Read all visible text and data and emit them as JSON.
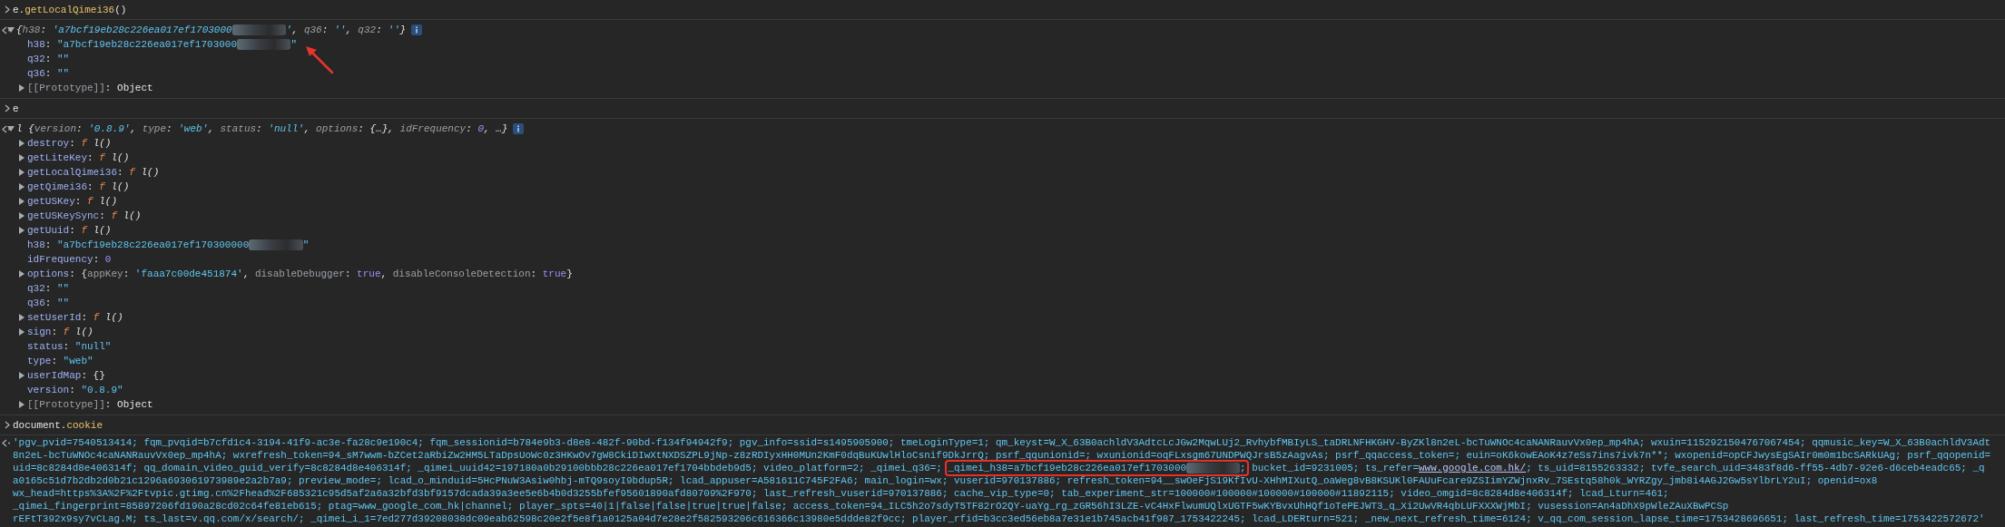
{
  "entries": [
    {
      "kind": "input",
      "tokens": [
        {
          "text": "e.",
          "kind": "punct"
        },
        {
          "text": "getLocalQimei36",
          "kind": "member"
        },
        {
          "text": "()",
          "kind": "punct"
        }
      ]
    },
    {
      "kind": "tree",
      "rows": [
        {
          "expandable": true,
          "expanded": true,
          "info": true,
          "tokens": [
            {
              "text": "{",
              "kind": "punct"
            },
            {
              "text": "h38",
              "kind": "dimkey"
            },
            {
              "text": ": ",
              "kind": "punct"
            },
            {
              "text": "'a7bcf19eb28c226ea017ef1703000",
              "kind": "string"
            },
            {
              "kind": "redacted"
            },
            {
              "text": "'",
              "kind": "string"
            },
            {
              "text": ", ",
              "kind": "punct"
            },
            {
              "text": "q36",
              "kind": "dimkey"
            },
            {
              "text": ": ",
              "kind": "punct"
            },
            {
              "text": "''",
              "kind": "string"
            },
            {
              "text": ", ",
              "kind": "punct"
            },
            {
              "text": "q32",
              "kind": "dimkey"
            },
            {
              "text": ": ",
              "kind": "punct"
            },
            {
              "text": "''",
              "kind": "string"
            },
            {
              "text": "}",
              "kind": "punct"
            }
          ],
          "children": [
            {
              "expandable": false,
              "expanded": false,
              "marked": true,
              "tokens": [
                {
                  "text": "h38",
                  "kind": "key"
                },
                {
                  "text": ": ",
                  "kind": "punct"
                },
                {
                  "text": "\"a7bcf19eb28c226ea017ef1703000",
                  "kind": "string"
                },
                {
                  "kind": "redacted"
                },
                {
                  "text": "\"",
                  "kind": "string"
                }
              ]
            },
            {
              "expandable": false,
              "expanded": false,
              "marked": false,
              "tokens": [
                {
                  "text": "q32",
                  "kind": "key"
                },
                {
                  "text": ": ",
                  "kind": "punct"
                },
                {
                  "text": "\"\"",
                  "kind": "string"
                }
              ]
            },
            {
              "expandable": false,
              "expanded": false,
              "marked": false,
              "tokens": [
                {
                  "text": "q36",
                  "kind": "key"
                },
                {
                  "text": ": ",
                  "kind": "punct"
                },
                {
                  "text": "\"\"",
                  "kind": "string"
                }
              ]
            },
            {
              "expandable": true,
              "expanded": false,
              "marked": false,
              "tokens": [
                {
                  "text": "[[Prototype]]",
                  "kind": "dimkey"
                },
                {
                  "text": ": ",
                  "kind": "punct"
                },
                {
                  "text": "Object",
                  "kind": "punct"
                }
              ]
            }
          ]
        }
      ]
    },
    {
      "kind": "input",
      "tokens": [
        {
          "text": "e",
          "kind": "punct"
        }
      ]
    },
    {
      "kind": "tree",
      "rows": [
        {
          "expandable": true,
          "expanded": true,
          "info": true,
          "tokens": [
            {
              "text": "l {",
              "kind": "punct"
            },
            {
              "text": "version",
              "kind": "dimkey"
            },
            {
              "text": ": ",
              "kind": "punct"
            },
            {
              "text": "'0.8.9'",
              "kind": "string"
            },
            {
              "text": ", ",
              "kind": "punct"
            },
            {
              "text": "type",
              "kind": "dimkey"
            },
            {
              "text": ": ",
              "kind": "punct"
            },
            {
              "text": "'web'",
              "kind": "string"
            },
            {
              "text": ", ",
              "kind": "punct"
            },
            {
              "text": "status",
              "kind": "dimkey"
            },
            {
              "text": ": ",
              "kind": "punct"
            },
            {
              "text": "'null'",
              "kind": "string"
            },
            {
              "text": ", ",
              "kind": "punct"
            },
            {
              "text": "options",
              "kind": "dimkey"
            },
            {
              "text": ": {…}, ",
              "kind": "punct"
            },
            {
              "text": "idFrequency",
              "kind": "dimkey"
            },
            {
              "text": ": ",
              "kind": "punct"
            },
            {
              "text": "0",
              "kind": "number"
            },
            {
              "text": ", …}",
              "kind": "punct"
            }
          ],
          "children": [
            {
              "expandable": true,
              "expanded": false,
              "tokens": [
                {
                  "text": "destroy",
                  "kind": "key"
                },
                {
                  "text": ": ",
                  "kind": "punct"
                },
                {
                  "text": "f",
                  "kind": "func"
                },
                {
                  "text": " l()",
                  "kind": "fname"
                }
              ]
            },
            {
              "expandable": true,
              "expanded": false,
              "tokens": [
                {
                  "text": "getLiteKey",
                  "kind": "key"
                },
                {
                  "text": ": ",
                  "kind": "punct"
                },
                {
                  "text": "f",
                  "kind": "func"
                },
                {
                  "text": " l()",
                  "kind": "fname"
                }
              ]
            },
            {
              "expandable": true,
              "expanded": false,
              "tokens": [
                {
                  "text": "getLocalQimei36",
                  "kind": "key"
                },
                {
                  "text": ": ",
                  "kind": "punct"
                },
                {
                  "text": "f",
                  "kind": "func"
                },
                {
                  "text": " l()",
                  "kind": "fname"
                }
              ]
            },
            {
              "expandable": true,
              "expanded": false,
              "tokens": [
                {
                  "text": "getQimei36",
                  "kind": "key"
                },
                {
                  "text": ": ",
                  "kind": "punct"
                },
                {
                  "text": "f",
                  "kind": "func"
                },
                {
                  "text": " l()",
                  "kind": "fname"
                }
              ]
            },
            {
              "expandable": true,
              "expanded": false,
              "tokens": [
                {
                  "text": "getUSKey",
                  "kind": "key"
                },
                {
                  "text": ": ",
                  "kind": "punct"
                },
                {
                  "text": "f",
                  "kind": "func"
                },
                {
                  "text": " l()",
                  "kind": "fname"
                }
              ]
            },
            {
              "expandable": true,
              "expanded": false,
              "tokens": [
                {
                  "text": "getUSKeySync",
                  "kind": "key"
                },
                {
                  "text": ": ",
                  "kind": "punct"
                },
                {
                  "text": "f",
                  "kind": "func"
                },
                {
                  "text": " l()",
                  "kind": "fname"
                }
              ]
            },
            {
              "expandable": true,
              "expanded": false,
              "tokens": [
                {
                  "text": "getUuid",
                  "kind": "key"
                },
                {
                  "text": ": ",
                  "kind": "punct"
                },
                {
                  "text": "f",
                  "kind": "func"
                },
                {
                  "text": " l()",
                  "kind": "fname"
                }
              ]
            },
            {
              "expandable": false,
              "expanded": false,
              "tokens": [
                {
                  "text": "h38",
                  "kind": "key"
                },
                {
                  "text": ": ",
                  "kind": "punct"
                },
                {
                  "text": "\"a7bcf19eb28c226ea017ef170300000",
                  "kind": "string"
                },
                {
                  "kind": "redacted"
                },
                {
                  "text": "\"",
                  "kind": "string"
                }
              ]
            },
            {
              "expandable": false,
              "expanded": false,
              "tokens": [
                {
                  "text": "idFrequency",
                  "kind": "key"
                },
                {
                  "text": ": ",
                  "kind": "punct"
                },
                {
                  "text": "0",
                  "kind": "number"
                }
              ]
            },
            {
              "expandable": true,
              "expanded": false,
              "tokens": [
                {
                  "text": "options",
                  "kind": "key"
                },
                {
                  "text": ": {",
                  "kind": "punct"
                },
                {
                  "text": "appKey",
                  "kind": "dimkey"
                },
                {
                  "text": ": ",
                  "kind": "punct"
                },
                {
                  "text": "'faaa7c00de451874'",
                  "kind": "string"
                },
                {
                  "text": ", ",
                  "kind": "punct"
                },
                {
                  "text": "disableDebugger",
                  "kind": "dimkey"
                },
                {
                  "text": ": ",
                  "kind": "punct"
                },
                {
                  "text": "true",
                  "kind": "bool"
                },
                {
                  "text": ", ",
                  "kind": "punct"
                },
                {
                  "text": "disableConsoleDetection",
                  "kind": "dimkey"
                },
                {
                  "text": ": ",
                  "kind": "punct"
                },
                {
                  "text": "true",
                  "kind": "bool"
                },
                {
                  "text": "}",
                  "kind": "punct"
                }
              ]
            },
            {
              "expandable": false,
              "expanded": false,
              "tokens": [
                {
                  "text": "q32",
                  "kind": "key"
                },
                {
                  "text": ": ",
                  "kind": "punct"
                },
                {
                  "text": "\"\"",
                  "kind": "string"
                }
              ]
            },
            {
              "expandable": false,
              "expanded": false,
              "tokens": [
                {
                  "text": "q36",
                  "kind": "key"
                },
                {
                  "text": ": ",
                  "kind": "punct"
                },
                {
                  "text": "\"\"",
                  "kind": "string"
                }
              ]
            },
            {
              "expandable": true,
              "expanded": false,
              "tokens": [
                {
                  "text": "setUserId",
                  "kind": "key"
                },
                {
                  "text": ": ",
                  "kind": "punct"
                },
                {
                  "text": "f",
                  "kind": "func"
                },
                {
                  "text": " l()",
                  "kind": "fname"
                }
              ]
            },
            {
              "expandable": true,
              "expanded": false,
              "tokens": [
                {
                  "text": "sign",
                  "kind": "key"
                },
                {
                  "text": ": ",
                  "kind": "punct"
                },
                {
                  "text": "f",
                  "kind": "func"
                },
                {
                  "text": " l()",
                  "kind": "fname"
                }
              ]
            },
            {
              "expandable": false,
              "expanded": false,
              "tokens": [
                {
                  "text": "status",
                  "kind": "key"
                },
                {
                  "text": ": ",
                  "kind": "punct"
                },
                {
                  "text": "\"null\"",
                  "kind": "string"
                }
              ]
            },
            {
              "expandable": false,
              "expanded": false,
              "tokens": [
                {
                  "text": "type",
                  "kind": "key"
                },
                {
                  "text": ": ",
                  "kind": "punct"
                },
                {
                  "text": "\"web\"",
                  "kind": "string"
                }
              ]
            },
            {
              "expandable": true,
              "expanded": false,
              "tokens": [
                {
                  "text": "userIdMap",
                  "kind": "key"
                },
                {
                  "text": ": {}",
                  "kind": "punct"
                }
              ]
            },
            {
              "expandable": false,
              "expanded": false,
              "tokens": [
                {
                  "text": "version",
                  "kind": "key"
                },
                {
                  "text": ": ",
                  "kind": "punct"
                },
                {
                  "text": "\"0.8.9\"",
                  "kind": "string"
                }
              ]
            },
            {
              "expandable": true,
              "expanded": false,
              "tokens": [
                {
                  "text": "[[Prototype]]",
                  "kind": "dimkey"
                },
                {
                  "text": ": ",
                  "kind": "punct"
                },
                {
                  "text": "Object",
                  "kind": "punct"
                }
              ]
            }
          ]
        }
      ]
    },
    {
      "kind": "input",
      "tokens": [
        {
          "text": "document.",
          "kind": "punct"
        },
        {
          "text": "cookie",
          "kind": "member"
        }
      ]
    },
    {
      "kind": "text",
      "rows": [
        {
          "tokens": [
            {
              "text": "'pgv_pvid=7540513414; fqm_pvqid=b7cfd1c4-3194-41f9-ac3e-fa28c9e190c4; fqm_sessionid=b784e9b3-d8e8-482f-90bd-f134f94942f9; pgv_info=ssid=s1495905900; tmeLoginType=1; qm_keyst=W_X_63B0achldV3AdtcLcJGw2MqwLUj2_RvhybfMBIyLS_taDRLNFHKGHV-ByZKl8n2eL-bcTuWNOc4caNANRauvVx0ep_mp4hA; wxuin=1152921504767067454; qqmusic_key=W_X_63B0achldV3Adt",
              "kind": "string"
            }
          ]
        },
        {
          "tokens": [
            {
              "text": "8n2eL-bcTuWNOc4caNANRauvVx0ep_mp4hA; wxrefresh_token=94_sM7wwm-bZCet2aRbiZw2HM5LTaDpsUoWc0z3HKwOv7gW8CkiDIwXtNXDSZPL9jNp-z8zRDIyxHH0MUn2KmF0dqBuKUwlHloCsnif9DkJrrQ; psrf_qqunionid=; wxunionid=oqFLxsgm67UNDPWQJrsB5zAagvAs; psrf_qqaccess_token=; euin=oK6kowEAoK4z7eSs7ins7ivk7n**; wxopenid=opCFJwysEgSAIr0m0m1bcSARkUAg; psrf_qqopenid=",
              "kind": "string"
            }
          ]
        },
        {
          "tokens": [
            {
              "text": "uid=8c8284d8e406314f; qq_domain_video_guid_verify=8c8284d8e406314f; _qimei_uuid42=197180a0b29100bbb28c226ea017ef1704bbdeb9d5; video_platform=2; _qimei_q36=; ",
              "kind": "string"
            },
            {
              "kind": "boxed",
              "parts": [
                {
                  "text": "_qimei_h38=a7bcf19eb28c226ea017ef1703000",
                  "kind": "string"
                },
                {
                  "kind": "redacted"
                },
                {
                  "text": ";",
                  "kind": "string"
                }
              ]
            },
            {
              "text": " bucket_id=9231005; ts_refer=",
              "kind": "string"
            },
            {
              "text": "www.google.com.hk/",
              "kind": "link"
            },
            {
              "text": "; ts_uid=8155263332; tvfe_search_uid=3483f8d6-ff55-4db7-92e6-d6ceb4eadc65; _q",
              "kind": "string"
            }
          ]
        },
        {
          "tokens": [
            {
              "text": "a0165c51d7b2db2d0b21c1296a693061973989e2a2b7a9; preview_mode=; lcad_o_minduid=5HcPNuW3Asiw0hbj-mTQ9soyI9bdup5R; lcad_appuser=A581611C745F2FA6; main_login=wx; vuserid=970137886; refresh_token=94__swOeFjS19KfIvU-XHhMIXutQ_oaWeg8vB8KSUKl0FAUuFcare9ZSIimYZWjnxRv_7SEstq58h0k_WYRZgy_jmb8i4AGJ2Gw5sYlbrLY2uI; openid=ox8",
              "kind": "string"
            }
          ]
        },
        {
          "tokens": [
            {
              "text": "wx_head=https%3A%2F%2Ftvpic.gtimg.cn%2Fhead%2F685321c95d5af2a6a32bfd3bf9157dcada39a3ee5e6b4b0d3255bfef95601890afd80709%2F970; last_refresh_vuserid=970137886; cache_vip_type=0; tab_experiment_str=100000#100000#100000#100000#11892115; video_omgid=8c8284d8e406314f; lcad_Lturn=461;",
              "kind": "string"
            }
          ]
        },
        {
          "tokens": [
            {
              "text": "_qimei_fingerprint=85897206fd190a28cd02c64fe81eb615; ptag=www_google_com_hk|channel; player_spts=40|1|false|false|true|true|false; access_token=94_ILC5h2o7sdyT5TF82rO2QY-uaYg_rg_zGR56hI3LZE-vC4HxFlwumUQlxUGTF5wKYBvxUhHQf1oTePEJWT3_q_Xi2UwVR4qbLUFXXXWjMbI; vusession=An4aDhX9pWleZAuXBwPCSp",
              "kind": "string"
            }
          ]
        },
        {
          "tokens": [
            {
              "text": "rEFtT392x9sy7vCLag.M; ts_last=v.qq.com/x/search/; _qimei_i_1=7ed277d39208038dc09eab62598c20e2f5e8f1a0125a04d7e28e2f582593206c616366c13980e5ddde82f9cc; player_rfid=b3cc3ed56eb8a7e31e1b745acb41f987_1753422245; lcad_LDERturn=521; _new_next_refresh_time=6124; v_qq_com_session_lapse_time=1753428696651; last_refresh_time=1753422572672'",
              "kind": "string"
            }
          ]
        }
      ]
    }
  ]
}
